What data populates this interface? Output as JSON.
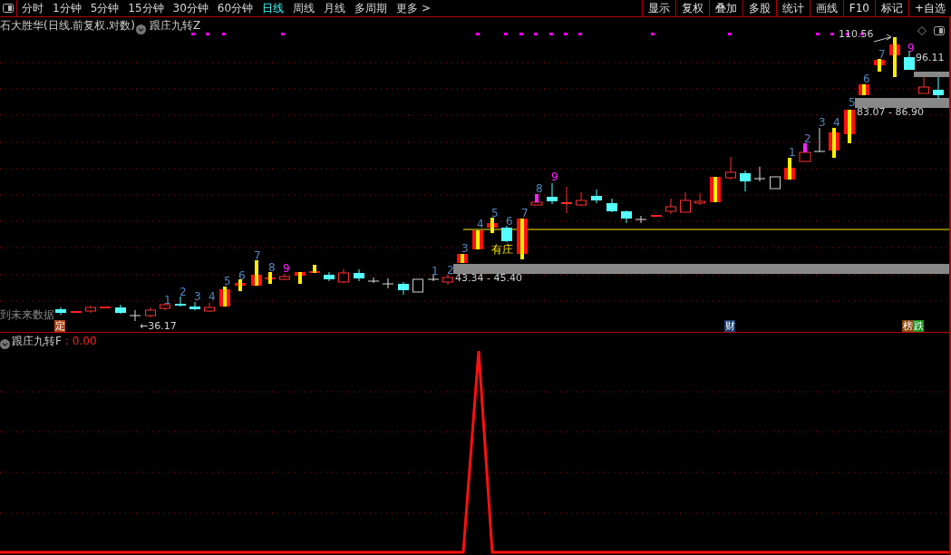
{
  "toolbar": {
    "periods": [
      {
        "label": "分时",
        "selected": false
      },
      {
        "label": "1分钟",
        "selected": false
      },
      {
        "label": "5分钟",
        "selected": false
      },
      {
        "label": "15分钟",
        "selected": false
      },
      {
        "label": "30分钟",
        "selected": false
      },
      {
        "label": "60分钟",
        "selected": false
      },
      {
        "label": "日线",
        "selected": true
      },
      {
        "label": "周线",
        "selected": false
      },
      {
        "label": "月线",
        "selected": false
      },
      {
        "label": "多周期",
        "selected": false
      },
      {
        "label": "更多 >",
        "selected": false
      }
    ],
    "actions": [
      "显示",
      "复权",
      "叠加",
      "多股",
      "统计",
      "画线",
      "F10",
      "标记",
      "+自选"
    ]
  },
  "main_panel": {
    "title": "石大胜华(日线.前复权.对数)",
    "indicator": "跟庄九转Z",
    "price_labels": [
      "110.56",
      "96.11",
      "83.07 - 86.90",
      "43.34 - 45.40",
      "←36.17"
    ],
    "zone_label": "有庄",
    "warning": "到未来数据",
    "counts": [
      {
        "text": "1",
        "color": "#4f86bd"
      },
      {
        "text": "2",
        "color": "#4f86bd"
      },
      {
        "text": "3",
        "color": "#4f86bd"
      },
      {
        "text": "4",
        "color": "#4f86bd"
      },
      {
        "text": "5",
        "color": "#4f86bd"
      },
      {
        "text": "6",
        "color": "#4f86bd"
      },
      {
        "text": "7",
        "color": "#4f86bd"
      },
      {
        "text": "8",
        "color": "#4f86bd"
      },
      {
        "text": "9",
        "color": "#ff22ff"
      },
      {
        "text": "1",
        "color": "#4f86bd"
      },
      {
        "text": "2",
        "color": "#4f86bd"
      },
      {
        "text": "3",
        "color": "#4f86bd"
      },
      {
        "text": "4",
        "color": "#4f86bd"
      },
      {
        "text": "5",
        "color": "#4f86bd"
      },
      {
        "text": "6",
        "color": "#4f86bd"
      },
      {
        "text": "7",
        "color": "#4f86bd"
      },
      {
        "text": "8",
        "color": "#4f86bd"
      },
      {
        "text": "9",
        "color": "#ff22ff"
      },
      {
        "text": "1",
        "color": "#4f86bd"
      },
      {
        "text": "2",
        "color": "#4f86bd"
      },
      {
        "text": "3",
        "color": "#4f86bd"
      },
      {
        "text": "4",
        "color": "#4f86bd"
      },
      {
        "text": "5",
        "color": "#4f86bd"
      },
      {
        "text": "6",
        "color": "#4f86bd"
      },
      {
        "text": "7",
        "color": "#4f86bd"
      },
      {
        "text": "9",
        "color": "#ff22ff"
      }
    ],
    "event_badges": [
      {
        "text": "定",
        "color": "#b04818"
      },
      {
        "text": "财",
        "color": "#1c3f70"
      },
      {
        "text": "榜",
        "color": "#8a4a12"
      },
      {
        "text": "跌",
        "color": "#12961e"
      }
    ]
  },
  "sub_panel": {
    "indicator": "跟庄九转F",
    "value": ": 0.00"
  }
}
